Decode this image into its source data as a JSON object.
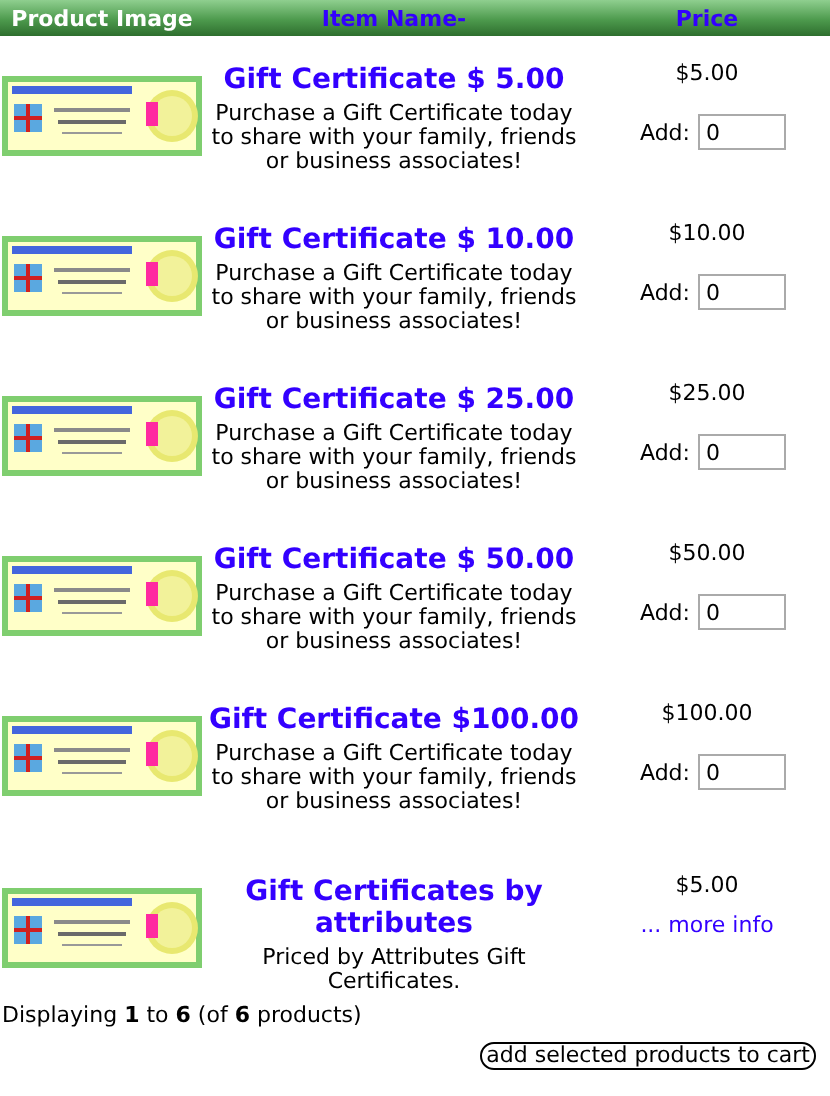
{
  "header": {
    "columns": [
      "Product Image",
      "Item Name-",
      "Price"
    ]
  },
  "products": [
    {
      "kind": "quantity",
      "name": "Gift Certificate $ 5.00",
      "description": "Purchase a Gift Certificate today to share with your family, friends or business associates!",
      "price": "$5.00",
      "add_label": "Add:",
      "quantity": "0"
    },
    {
      "kind": "quantity",
      "name": "Gift Certificate $ 10.00",
      "description": "Purchase a Gift Certificate today to share with your family, friends or business associates!",
      "price": "$10.00",
      "add_label": "Add:",
      "quantity": "0"
    },
    {
      "kind": "quantity",
      "name": "Gift Certificate $ 25.00",
      "description": "Purchase a Gift Certificate today to share with your family, friends or business associates!",
      "price": "$25.00",
      "add_label": "Add:",
      "quantity": "0"
    },
    {
      "kind": "quantity",
      "name": "Gift Certificate $ 50.00",
      "description": "Purchase a Gift Certificate today to share with your family, friends or business associates!",
      "price": "$50.00",
      "add_label": "Add:",
      "quantity": "0"
    },
    {
      "kind": "quantity",
      "name": "Gift Certificate $100.00",
      "description": "Purchase a Gift Certificate today to share with your family, friends or business associates!",
      "price": "$100.00",
      "add_label": "Add:",
      "quantity": "0"
    },
    {
      "kind": "more_info",
      "name": "Gift Certificates by attributes",
      "description": "Priced by Attributes Gift Certificates.",
      "price": "$5.00",
      "link": "... more info"
    }
  ],
  "footer": {
    "count": "Displaying **1** to **6** (of **6** products)",
    "button": "add selected products to cart"
  }
}
